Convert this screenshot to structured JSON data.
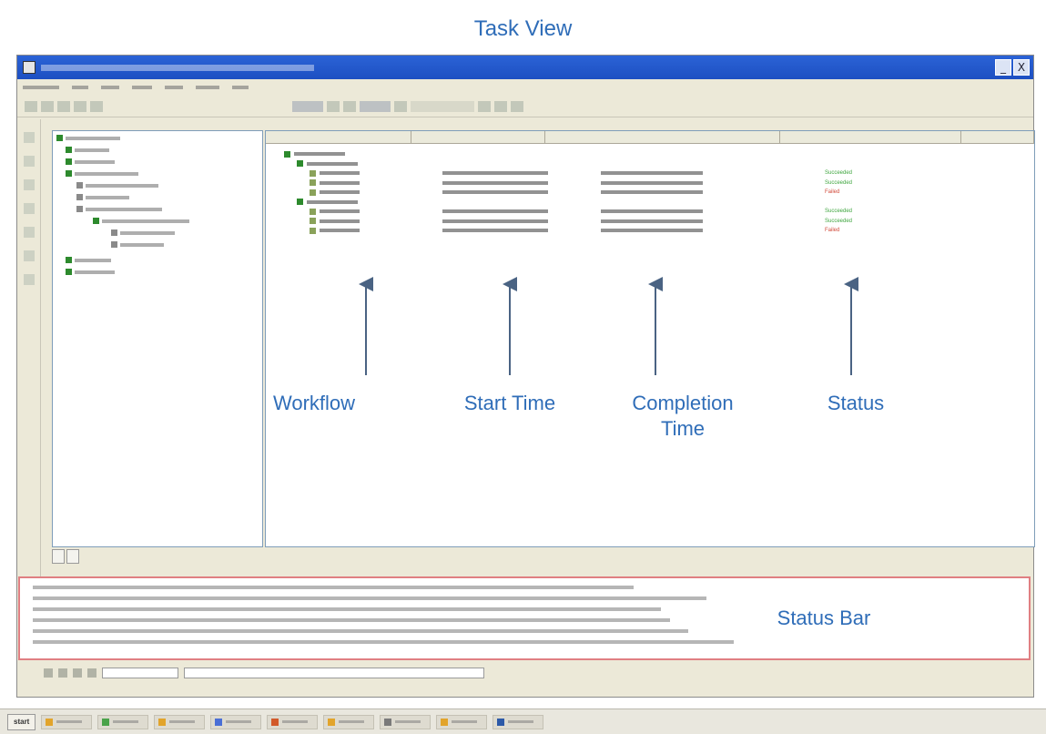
{
  "page_heading": "Task View",
  "window": {
    "title": "",
    "win_buttons": [
      "_",
      "X"
    ]
  },
  "task_table": {
    "columns": [
      "",
      "",
      "",
      "",
      ""
    ],
    "rows": [
      {
        "indent": 1,
        "start": "",
        "end": "",
        "status": "",
        "status_type": "none"
      },
      {
        "indent": 2,
        "start": "",
        "end": "",
        "status": "",
        "status_type": "none"
      },
      {
        "indent": 3,
        "start": "",
        "end": "",
        "status": "Succeeded",
        "status_type": "ok"
      },
      {
        "indent": 3,
        "start": "",
        "end": "",
        "status": "Succeeded",
        "status_type": "ok"
      },
      {
        "indent": 3,
        "start": "",
        "end": "",
        "status": "Failed",
        "status_type": "err"
      },
      {
        "indent": 2,
        "start": "",
        "end": "",
        "status": "",
        "status_type": "none"
      },
      {
        "indent": 3,
        "start": "",
        "end": "",
        "status": "Succeeded",
        "status_type": "ok"
      },
      {
        "indent": 3,
        "start": "",
        "end": "",
        "status": "Succeeded",
        "status_type": "ok"
      },
      {
        "indent": 3,
        "start": "",
        "end": "",
        "status": "Failed",
        "status_type": "err"
      }
    ]
  },
  "annotations": {
    "workflow": "Workflow",
    "start_time": "Start Time",
    "completion_time_line1": "Completion",
    "completion_time_line2": "Time",
    "status": "Status",
    "status_bar": "Status Bar"
  },
  "panel_tabs": [
    "",
    ""
  ],
  "taskbar": {
    "start": "start"
  },
  "colors": {
    "annotation": "#2f6db8",
    "status_bar_border": "#e07f82",
    "titlebar": "#2b63d6"
  }
}
